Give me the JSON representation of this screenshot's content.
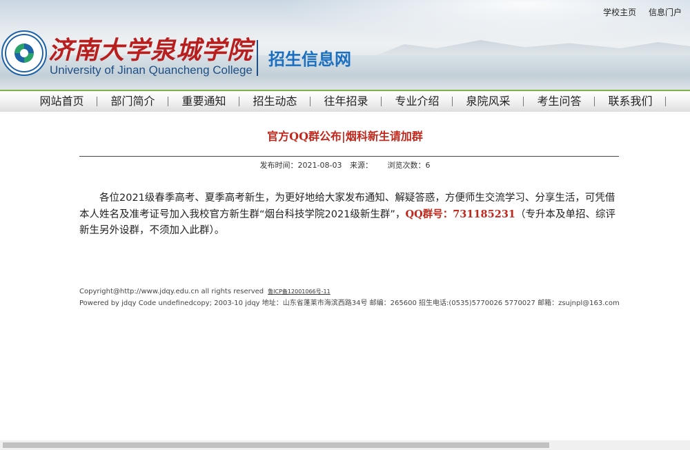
{
  "header": {
    "school_cn": "济南大学泉城学院",
    "school_en": "University of Jinan Quancheng College",
    "site_name": "招生信息网",
    "top_links": [
      "学校主页",
      "信息门户"
    ]
  },
  "nav": {
    "items": [
      "网站首页",
      "部门简介",
      "重要通知",
      "招生动态",
      "往年招录",
      "专业介绍",
      "泉院风采",
      "考生问答",
      "联系我们"
    ]
  },
  "article": {
    "title": "官方QQ群公布|烟科新生请加群",
    "meta": {
      "date_label": "发布时间：",
      "date": "2021-08-03",
      "source_label": "来源：",
      "views_label": "浏览次数：",
      "views": "6"
    },
    "body_part1": "各位2021级春季高考、夏季高考新生，为更好地给大家发布通知、解疑答惑，方便师生交流学习、分享生活，可凭借本人姓名及准考证号加入我校官方新生群“烟台科技学院2021级新生群”，",
    "qq_label": "QQ群号：731185231",
    "body_part2": "（专升本及单招、综评新生另外设群，不须加入此群）。"
  },
  "footer": {
    "line1": "Copyright@http://www.jdqy.edu.cn    all rights reserved",
    "icp": "鲁ICP备12001066号-11",
    "line2": "Powered by jdqy Code undefinedcopy; 2003-10 jdqy 地址：山东省蓬莱市海滨西路34号 邮编：265600 招生电话:(0535)5770026 5770027  邮箱：zsujnpl@163.com"
  },
  "colors": {
    "accent_red": "#c0281d",
    "brand_blue": "#1a6fc0",
    "nav_border_green": "#7fb24a"
  }
}
